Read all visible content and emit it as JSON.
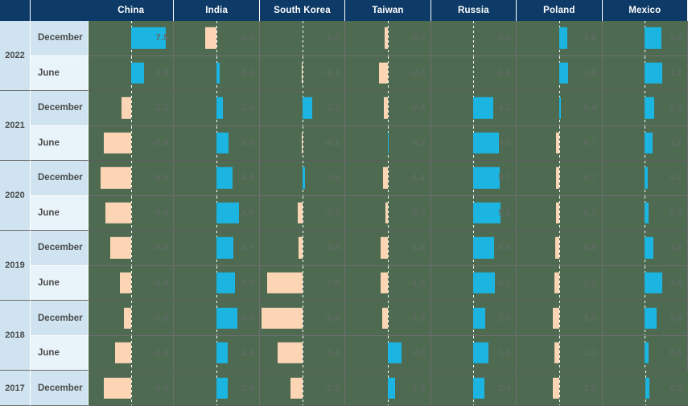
{
  "header": {
    "corner_left": "",
    "corner_right": "",
    "columns": [
      "China",
      "India",
      "South Korea",
      "Taiwan",
      "Russia",
      "Poland",
      "Mexico"
    ]
  },
  "colors": {
    "header_bg": "#0d3a66",
    "header_text": "#ffffff",
    "cell_bg": "#4e6b52",
    "positive_bar": "#1cb4e0",
    "negative_bar": "#fcd5b5",
    "label_row_dark": "#cfe4f0",
    "label_row_light": "#e9f3fa",
    "value_text": "#5f6b63",
    "gridline": "#6e6e6e"
  },
  "rows": [
    {
      "year": "2022",
      "month": "December",
      "shade": "dec"
    },
    {
      "year": "2022",
      "month": "June",
      "shade": "jun"
    },
    {
      "year": "2021",
      "month": "December",
      "shade": "dec"
    },
    {
      "year": "2021",
      "month": "June",
      "shade": "jun"
    },
    {
      "year": "2020",
      "month": "December",
      "shade": "dec"
    },
    {
      "year": "2020",
      "month": "June",
      "shade": "jun"
    },
    {
      "year": "2019",
      "month": "December",
      "shade": "dec"
    },
    {
      "year": "2019",
      "month": "June",
      "shade": "jun"
    },
    {
      "year": "2018",
      "month": "December",
      "shade": "dec"
    },
    {
      "year": "2018",
      "month": "June",
      "shade": "jun"
    },
    {
      "year": "2017",
      "month": "December",
      "shade": "solo"
    }
  ],
  "year_groups": [
    {
      "year": "2022",
      "span": 2
    },
    {
      "year": "2021",
      "span": 2
    },
    {
      "year": "2020",
      "span": 2
    },
    {
      "year": "2019",
      "span": 2
    },
    {
      "year": "2018",
      "span": 2
    },
    {
      "year": "2017",
      "span": 1
    }
  ],
  "chart_data": {
    "type": "bar",
    "title": "",
    "xlabel": "",
    "ylabel": "",
    "grid": true,
    "legend_position": "none",
    "orientation": "horizontal-diverging",
    "categories": [
      "2022 December",
      "2022 June",
      "2021 December",
      "2021 June",
      "2020 December",
      "2020 June",
      "2019 December",
      "2019 June",
      "2018 December",
      "2018 June",
      "2017 December"
    ],
    "max_abs": 8.8,
    "series": [
      {
        "name": "China",
        "values": [
          7.5,
          2.8,
          -2.1,
          -5.9,
          -6.5,
          -5.6,
          -4.4,
          -2.4,
          -1.5,
          -3.4,
          -5.9
        ]
      },
      {
        "name": "India",
        "values": [
          -2.4,
          0.6,
          1.4,
          2.6,
          3.4,
          4.8,
          3.7,
          3.9,
          4.5,
          2.4,
          2.4
        ]
      },
      {
        "name": "South Korea",
        "values": [
          0.0,
          -0.1,
          2.2,
          -0.1,
          0.6,
          -0.9,
          -0.8,
          -7.6,
          -8.8,
          -5.4,
          -2.6
        ]
      },
      {
        "name": "Taiwan",
        "values": [
          -0.7,
          -2.0,
          -0.8,
          0.2,
          -1.1,
          -0.5,
          -1.5,
          -1.5,
          -1.3,
          2.9,
          1.6
        ]
      },
      {
        "name": "Russia",
        "values": [
          0.0,
          0.0,
          4.2,
          5.5,
          5.7,
          5.8,
          4.5,
          4.7,
          2.5,
          3.3,
          2.4
        ]
      },
      {
        "name": "Poland",
        "values": [
          1.8,
          1.9,
          0.4,
          -0.7,
          -0.7,
          -0.7,
          -0.9,
          -1.1,
          -1.3,
          -1.1,
          -1.3
        ]
      },
      {
        "name": "Mexico",
        "values": [
          3.6,
          3.7,
          2.0,
          1.7,
          0.7,
          0.9,
          1.8,
          3.8,
          2.6,
          0.8,
          0.9
        ]
      }
    ]
  }
}
